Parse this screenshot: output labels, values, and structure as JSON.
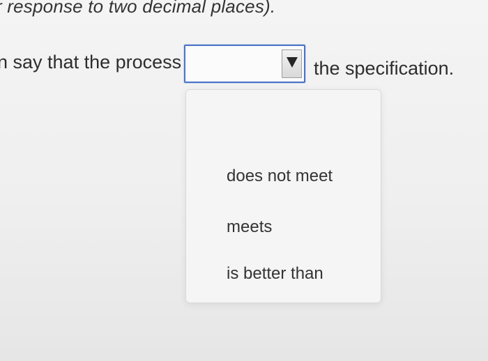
{
  "question": {
    "instruction_fragment": "r response to two decimal places).",
    "sentence_before": "n say that the process",
    "sentence_after": "the specification."
  },
  "dropdown": {
    "selected_value": "",
    "options": [
      "does not meet",
      "meets",
      "is better than"
    ]
  },
  "colors": {
    "select_border": "#4a74c7",
    "page_background": "#f0f0f0"
  },
  "icons": {
    "dropdown_arrow": "chevron-down-icon"
  }
}
